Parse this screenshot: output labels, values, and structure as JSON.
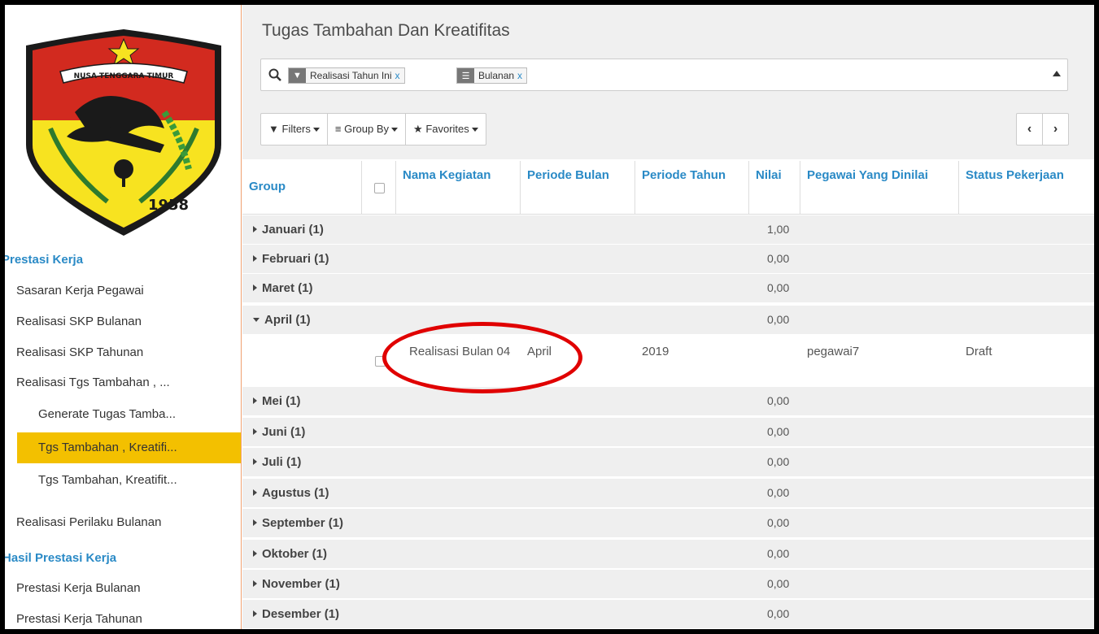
{
  "sidebar": {
    "section1": "Prestasi Kerja",
    "items": [
      "Sasaran Kerja Pegawai",
      "Realisasi SKP Bulanan",
      "Realisasi SKP Tahunan",
      "Realisasi Tgs Tambahan , ...",
      "Generate Tugas Tamba...",
      "Tgs Tambahan , Kreatifi...",
      "Tgs Tambahan, Kreatifit...",
      "Realisasi Perilaku Bulanan"
    ],
    "section2": "Hasil Prestasi Kerja",
    "items2": [
      "Prestasi Kerja Bulanan",
      "Prestasi Kerja Tahunan"
    ],
    "logo_text_banner": "NUSA TENGGARA TIMUR",
    "logo_year": "1958"
  },
  "header": {
    "title": "Tugas Tambahan Dan Kreatifitas"
  },
  "search": {
    "facets": [
      {
        "icon": "filter-icon",
        "value": "Realisasi Tahun Ini",
        "remove": "x"
      },
      {
        "icon": "list-icon",
        "value": "Bulanan",
        "remove": "x"
      }
    ]
  },
  "toolbar": {
    "filters": "Filters",
    "group_by": "Group By",
    "favorites": "Favorites",
    "prev": "‹",
    "next": "›"
  },
  "table": {
    "columns": [
      "Group",
      "Nama Kegiatan",
      "Periode Bulan",
      "Periode Tahun",
      "Nilai",
      "Pegawai Yang Dinilai",
      "Status Pekerjaan"
    ],
    "groups": [
      {
        "label": "Januari (1)",
        "value": "1,00"
      },
      {
        "label": "Februari (1)",
        "value": "0,00"
      },
      {
        "label": "Maret (1)",
        "value": "0,00"
      },
      {
        "label": "April (1)",
        "value": "0,00"
      },
      {
        "label": "Mei (1)",
        "value": "0,00"
      },
      {
        "label": "Juni (1)",
        "value": "0,00"
      },
      {
        "label": "Juli (1)",
        "value": "0,00"
      },
      {
        "label": "Agustus (1)",
        "value": "0,00"
      },
      {
        "label": "September (1)",
        "value": "0,00"
      },
      {
        "label": "Oktober (1)",
        "value": "0,00"
      },
      {
        "label": "November (1)",
        "value": "0,00"
      },
      {
        "label": "Desember (1)",
        "value": "0,00"
      }
    ],
    "record": {
      "nama_kegiatan": "Realisasi Bulan 04",
      "periode_bulan": "April",
      "periode_tahun": "2019",
      "pegawai": "pegawai7",
      "status": "Draft"
    }
  },
  "colors": {
    "accent_blue": "#2a8ac6",
    "active_menu": "#f3c000",
    "annotation_circle": "#e00000"
  }
}
